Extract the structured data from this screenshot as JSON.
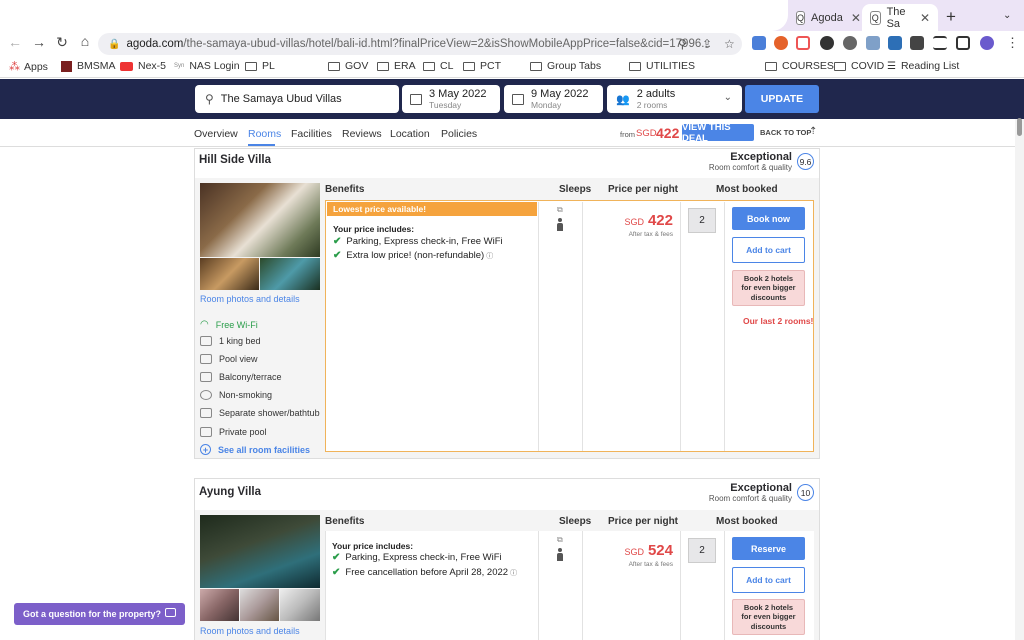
{
  "browser": {
    "tabs": [
      {
        "label": "Agoda",
        "favicon": "Q"
      },
      {
        "label": "The Sa",
        "favicon": "Q"
      }
    ],
    "new_tab": "+",
    "url_domain": "agoda.com",
    "url_path": "/the-samaya-ubud-villas/hotel/bali-id.html?finalPriceView=2&isShowMobileAppPrice=false&cid=17996...",
    "bookmarks": [
      "Apps",
      "BMSMA",
      "Nex-5",
      "NAS Login",
      "PL",
      "GOV",
      "ERA",
      "CL",
      "PCT",
      "Group Tabs",
      "UTILITIES",
      "COURSES",
      "COVID",
      "Reading List"
    ]
  },
  "search": {
    "hotel": "The Samaya Ubud Villas",
    "checkin": {
      "date": "3 May 2022",
      "day": "Tuesday"
    },
    "checkout": {
      "date": "9 May 2022",
      "day": "Monday"
    },
    "guests": {
      "adults": "2 adults",
      "rooms": "2 rooms"
    },
    "update_label": "UPDATE"
  },
  "subnav": {
    "items": [
      "Overview",
      "Rooms",
      "Facilities",
      "Reviews",
      "Location",
      "Policies"
    ],
    "from_label": "from",
    "from_currency": "SGD",
    "from_price": "422",
    "deal_label": "VIEW THIS DEAL",
    "back_label": "BACK TO TOP"
  },
  "columns": {
    "benefits": "Benefits",
    "sleeps": "Sleeps",
    "price": "Price per night",
    "most": "Most booked"
  },
  "rooms": [
    {
      "name": "Hill Side Villa",
      "rating": "Exceptional",
      "rating_sub": "Room comfort & quality",
      "score": "9.6",
      "photos_link": "Room photos and details",
      "features": [
        "Free Wi-Fi",
        "1 king bed",
        "Pool view",
        "Balcony/terrace",
        "Non-smoking",
        "Separate shower/bathtub",
        "Private pool"
      ],
      "see_all": "See all room facilities",
      "banner": "Lowest price available!",
      "includes": "Your price includes:",
      "benefits": [
        "Parking, Express check-in, Free WiFi",
        "Extra low price! (non-refundable)"
      ],
      "currency": "SGD",
      "price": "422",
      "tax": "After tax & fees",
      "qty": "2",
      "book": "Book now",
      "cart": "Add to cart",
      "promo": "Book 2 hotels for even bigger discounts",
      "last": "Our last 2 rooms!"
    },
    {
      "name": "Ayung Villa",
      "rating": "Exceptional",
      "rating_sub": "Room comfort & quality",
      "score": "10",
      "photos_link": "Room photos and details",
      "includes": "Your price includes:",
      "benefits": [
        "Parking, Express check-in, Free WiFi",
        "Free cancellation before April 28, 2022"
      ],
      "currency": "SGD",
      "price": "524",
      "tax": "After tax & fees",
      "qty": "2",
      "book": "Reserve",
      "cart": "Add to cart",
      "promo": "Book 2 hotels for even bigger discounts"
    }
  ],
  "question": "Got a question for the property?"
}
